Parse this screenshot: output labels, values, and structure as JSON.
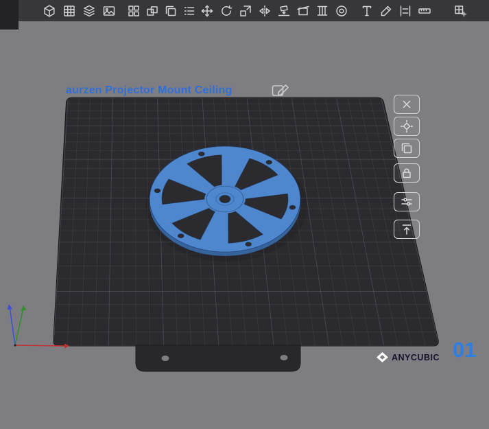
{
  "app": {
    "background": "#7e7e82",
    "toolbar_bg": "#37373a",
    "corner_bg": "#232327",
    "icon_color": "#d2d2d5"
  },
  "top_toolbar": {
    "groups": [
      [
        "import-model",
        "workspace-grid",
        "slice-layers",
        "preview-image"
      ],
      [
        "arrange-objects",
        "merge-objects",
        "copy-object",
        "object-list"
      ],
      [
        "move-tool",
        "rotate-tool",
        "scale-tool",
        "mirror-tool",
        "lay-flat-tool",
        "cut-tool",
        "support-tool",
        "hollow-tool"
      ],
      [
        "text-tool",
        "paint-tool",
        "align-tool",
        "measure-tool"
      ],
      [
        "add-build-plate"
      ]
    ]
  },
  "right_toolbar": {
    "items": [
      "delete-object",
      "auto-arrange",
      "duplicate-object",
      "lock-object",
      "object-settings",
      "move-to-top"
    ]
  },
  "scene": {
    "model_label": "aurzen Projector Mount Ceiling",
    "rename_icon": "pencil-edit-icon",
    "label_color": "#2e6fd8",
    "model_color": "#4e87cd",
    "model_side_color": "#35639b",
    "plate_color": "#2b2b2f",
    "axes": {
      "x_color": "#c03030",
      "y_color": "#2f8f2f",
      "z_color": "#3f4fd8"
    }
  },
  "footer": {
    "brand": "ANYCUBIC",
    "plate_number": "01",
    "plate_number_color": "#2e7ee4"
  }
}
